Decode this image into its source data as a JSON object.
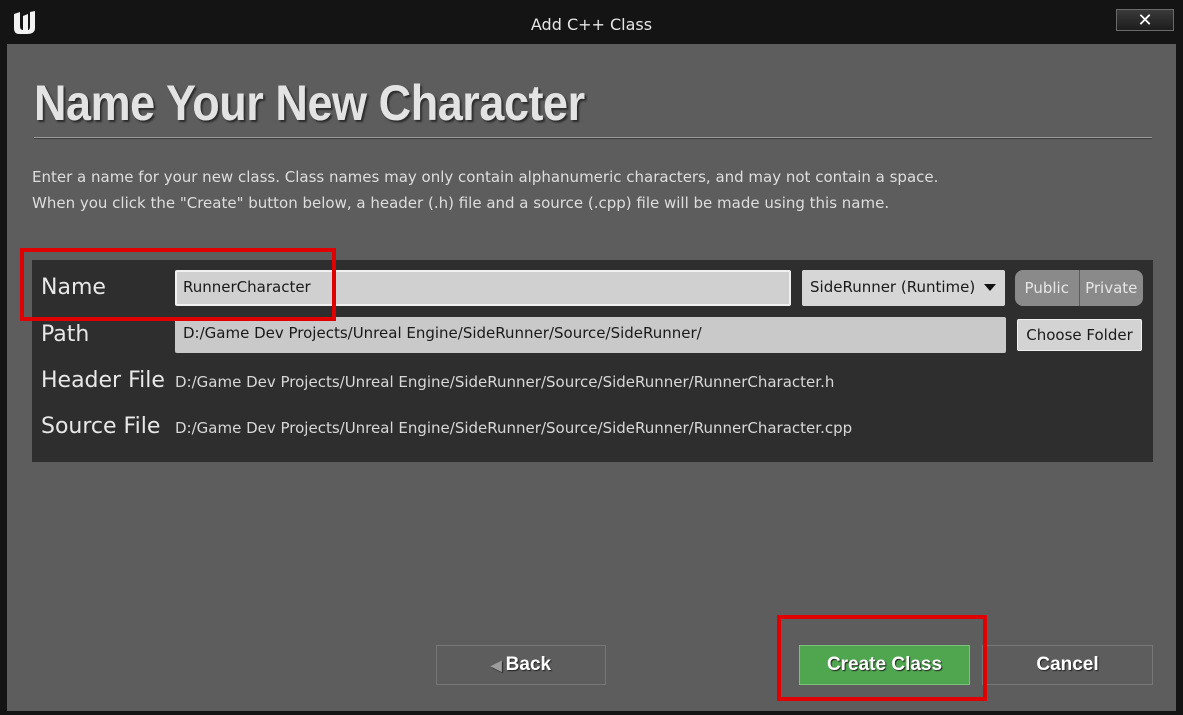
{
  "window": {
    "title": "Add C++ Class",
    "close_label": "✕"
  },
  "page": {
    "heading": "Name Your New Character",
    "description_line1": "Enter a name for your new class. Class names may only contain alphanumeric characters, and may not contain a space.",
    "description_line2": "When you click the \"Create\" button below, a header (.h) file and a source (.cpp) file will be made using this name."
  },
  "form": {
    "name_label": "Name",
    "name_value": "RunnerCharacter",
    "module_value": "SideRunner (Runtime)",
    "visibility_options": [
      "Public",
      "Private"
    ],
    "path_label": "Path",
    "path_value": "D:/Game Dev Projects/Unreal Engine/SideRunner/Source/SideRunner/",
    "choose_folder_label": "Choose Folder",
    "header_file_label": "Header File",
    "header_file_value": "D:/Game Dev Projects/Unreal Engine/SideRunner/Source/SideRunner/RunnerCharacter.h",
    "source_file_label": "Source File",
    "source_file_value": "D:/Game Dev Projects/Unreal Engine/SideRunner/Source/SideRunner/RunnerCharacter.cpp"
  },
  "footer": {
    "back_label": "Back",
    "create_label": "Create Class",
    "cancel_label": "Cancel"
  },
  "colors": {
    "create_button": "#4fa64f",
    "highlight": "#e00000",
    "dialog_background": "#5d5d5d",
    "panel_background": "#2e2e2e"
  }
}
